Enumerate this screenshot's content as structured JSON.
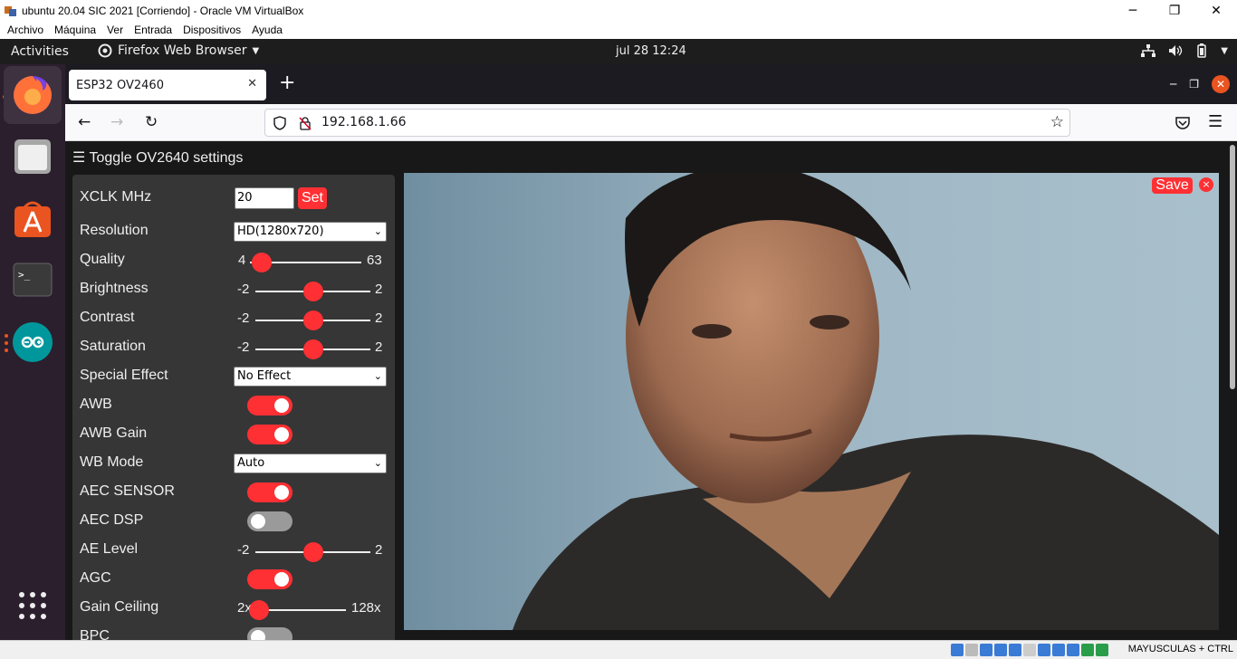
{
  "vbox": {
    "title": "ubuntu 20.04 SIC 2021 [Corriendo] - Oracle VM VirtualBox",
    "menu": [
      "Archivo",
      "Máquina",
      "Ver",
      "Entrada",
      "Dispositivos",
      "Ayuda"
    ],
    "status_hostkey": "MAYUSCULAS + CTRL"
  },
  "gnome": {
    "activities": "Activities",
    "app_menu": "Firefox Web Browser",
    "clock": "jul 28  12:24"
  },
  "dock": {
    "items": [
      "firefox-icon",
      "files-icon",
      "software-center-icon",
      "terminal-icon",
      "arduino-icon"
    ],
    "show_apps": "grid-icon"
  },
  "firefox": {
    "tab_title": "ESP32 OV2460",
    "url": "192.168.1.66"
  },
  "page": {
    "toggle_header": "Toggle OV2640 settings",
    "xclk": {
      "label": "XCLK MHz",
      "value": "20",
      "button": "Set"
    },
    "resolution": {
      "label": "Resolution",
      "value": "HD(1280x720)"
    },
    "quality": {
      "label": "Quality",
      "min": "4",
      "max": "63",
      "value": 10
    },
    "brightness": {
      "label": "Brightness",
      "min": "-2",
      "max": "2",
      "value": 0
    },
    "contrast": {
      "label": "Contrast",
      "min": "-2",
      "max": "2",
      "value": 0
    },
    "saturation": {
      "label": "Saturation",
      "min": "-2",
      "max": "2",
      "value": 0
    },
    "special_effect": {
      "label": "Special Effect",
      "value": "No Effect"
    },
    "awb": {
      "label": "AWB",
      "on": true
    },
    "awb_gain": {
      "label": "AWB Gain",
      "on": true
    },
    "wb_mode": {
      "label": "WB Mode",
      "value": "Auto"
    },
    "aec_sensor": {
      "label": "AEC SENSOR",
      "on": true
    },
    "aec_dsp": {
      "label": "AEC DSP",
      "on": false
    },
    "ae_level": {
      "label": "AE Level",
      "min": "-2",
      "max": "2",
      "value": 0
    },
    "agc": {
      "label": "AGC",
      "on": true
    },
    "gain_ceiling": {
      "label": "Gain Ceiling",
      "min": "2x",
      "max": "128x",
      "value": 0
    },
    "bpc": {
      "label": "BPC",
      "on": false
    },
    "save_label": "Save",
    "close_label": "×"
  },
  "colors": {
    "accent": "#ff3034",
    "panel": "#363636",
    "background": "#181818"
  }
}
